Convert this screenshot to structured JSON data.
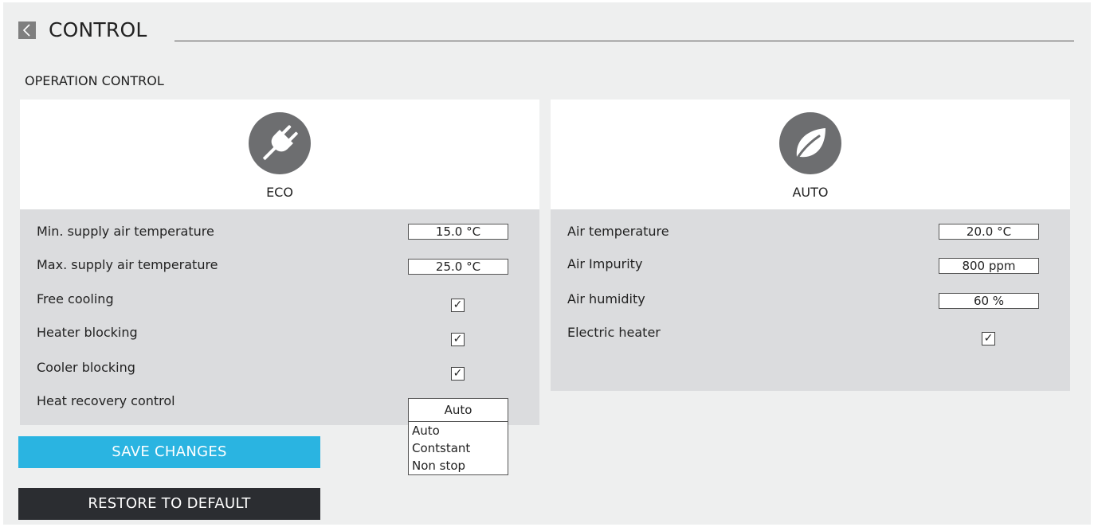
{
  "header": {
    "title": "CONTROL"
  },
  "section": {
    "title": "OPERATION CONTROL"
  },
  "eco": {
    "mode_label": "ECO",
    "icon": "plug-icon",
    "rows": {
      "min_supply_label": "Min. supply air temperature",
      "min_supply_value": "15.0  °C",
      "max_supply_label": "Max. supply air temperature",
      "max_supply_value": "25.0 °C",
      "free_cooling_label": "Free cooling",
      "free_cooling_checked": true,
      "heater_blocking_label": "Heater blocking",
      "heater_blocking_checked": true,
      "cooler_blocking_label": "Cooler blocking",
      "cooler_blocking_checked": true,
      "heat_recovery_label": "Heat recovery control"
    },
    "heat_recovery_dropdown": {
      "selected": "Auto",
      "options": [
        "Auto",
        "Contstant",
        "Non stop"
      ]
    }
  },
  "auto": {
    "mode_label": "AUTO",
    "icon": "leaf-icon",
    "rows": {
      "air_temp_label": "Air temperature",
      "air_temp_value": "20.0  °C",
      "air_impurity_label": "Air Impurity",
      "air_impurity_value": "800 ppm",
      "air_humidity_label": "Air humidity",
      "air_humidity_value": "60 %",
      "electric_heater_label": "Electric heater",
      "electric_heater_checked": true
    }
  },
  "buttons": {
    "save_label": "SAVE CHANGES",
    "restore_label": "RESTORE TO DEFAULT"
  },
  "colors": {
    "background": "#eeefef",
    "panel_body": "#dbdcde",
    "save_button": "#2ab4e1",
    "restore_button": "#2b2d31",
    "icon_grey": "#6d6e70"
  },
  "checkmark": "✓"
}
